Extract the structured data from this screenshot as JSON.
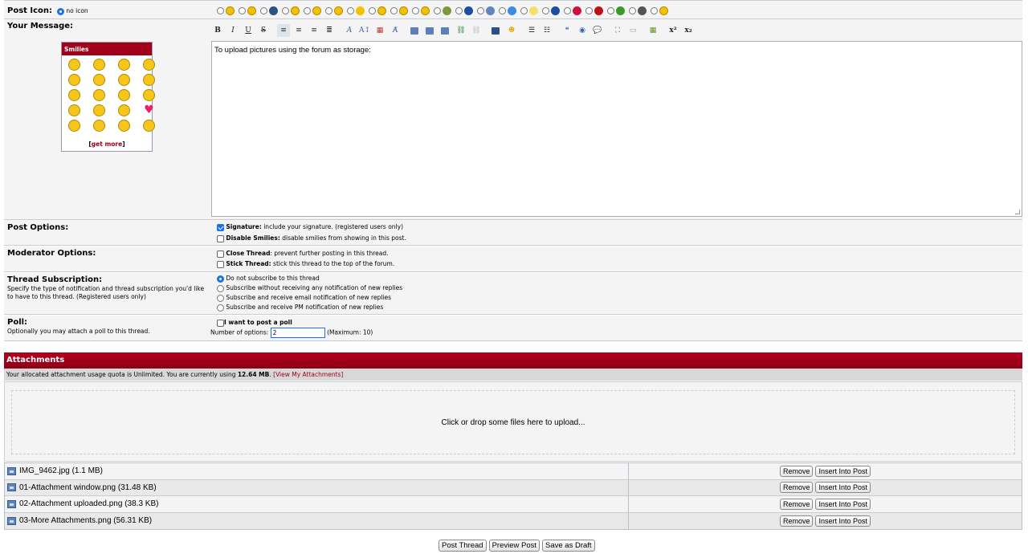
{
  "post_icon": {
    "label": "Post Icon:",
    "no_icon_label": "no icon",
    "icons": [
      "smile-icon",
      "happy-icon",
      "film-icon",
      "smile2-icon",
      "thumbsup-icon",
      "thumbsdown-icon",
      "star-icon",
      "laugh-icon",
      "grin-icon",
      "wink-icon",
      "pencil-icon",
      "question-icon",
      "picture-icon",
      "music-icon",
      "lightbulb-icon",
      "info-icon",
      "heart-icon",
      "exclamation-icon",
      "bug-icon",
      "clapper-icon",
      "sad-icon"
    ]
  },
  "message": {
    "label": "Your Message:",
    "text": "To upload pictures using the forum as storage:"
  },
  "smilies": {
    "title": "Smilies",
    "get_more_prefix": "[",
    "get_more_link": "get more",
    "get_more_suffix": "]"
  },
  "toolbar": {
    "bold": "B",
    "italic": "I",
    "underline": "U",
    "strike": "S",
    "superscript": "x²",
    "subscript": "x₂"
  },
  "post_options": {
    "label": "Post Options:",
    "signature_bold": "Signature:",
    "signature_text": " include your signature. (registered users only)",
    "disable_smilies_bold": "Disable Smilies:",
    "disable_smilies_text": " disable smilies from showing in this post."
  },
  "moderator_options": {
    "label": "Moderator Options:",
    "close_bold": "Close Thread",
    "close_text": ": prevent further posting in this thread.",
    "stick_bold": "Stick Thread:",
    "stick_text": " stick this thread to the top of the forum."
  },
  "subscription": {
    "label": "Thread Subscription:",
    "desc": "Specify the type of notification and thread subscription you'd like to have to this thread. (Registered users only)",
    "options": [
      "Do not subscribe to this thread",
      "Subscribe without receiving any notification of new replies",
      "Subscribe and receive email notification of new replies",
      "Subscribe and receive PM notification of new replies"
    ]
  },
  "poll": {
    "label": "Poll:",
    "desc": "Optionally you may attach a poll to this thread.",
    "checkbox_label": "I want to post a poll",
    "num_label": "Number of options:",
    "num_value": "2",
    "max_label": "(Maximum: 10)"
  },
  "attachments": {
    "title": "Attachments",
    "quota_prefix": "Your allocated attachment usage quota is Unlimited. You are currently using ",
    "quota_value": "12.64 MB",
    "quota_suffix": ". ",
    "quota_link": "[View My Attachments]",
    "dropzone": "Click or drop some files here to upload...",
    "remove_label": "Remove",
    "insert_label": "Insert Into Post",
    "files": [
      "IMG_9462.jpg (1.1 MB)",
      "01-Attachment window.png (31.48 KB)",
      "02-Attachment uploaded.png (38.3 KB)",
      "03-More Attachments.png (56.31 KB)"
    ]
  },
  "buttons": {
    "post_thread": "Post Thread",
    "preview_post": "Preview Post",
    "save_draft": "Save as Draft"
  }
}
